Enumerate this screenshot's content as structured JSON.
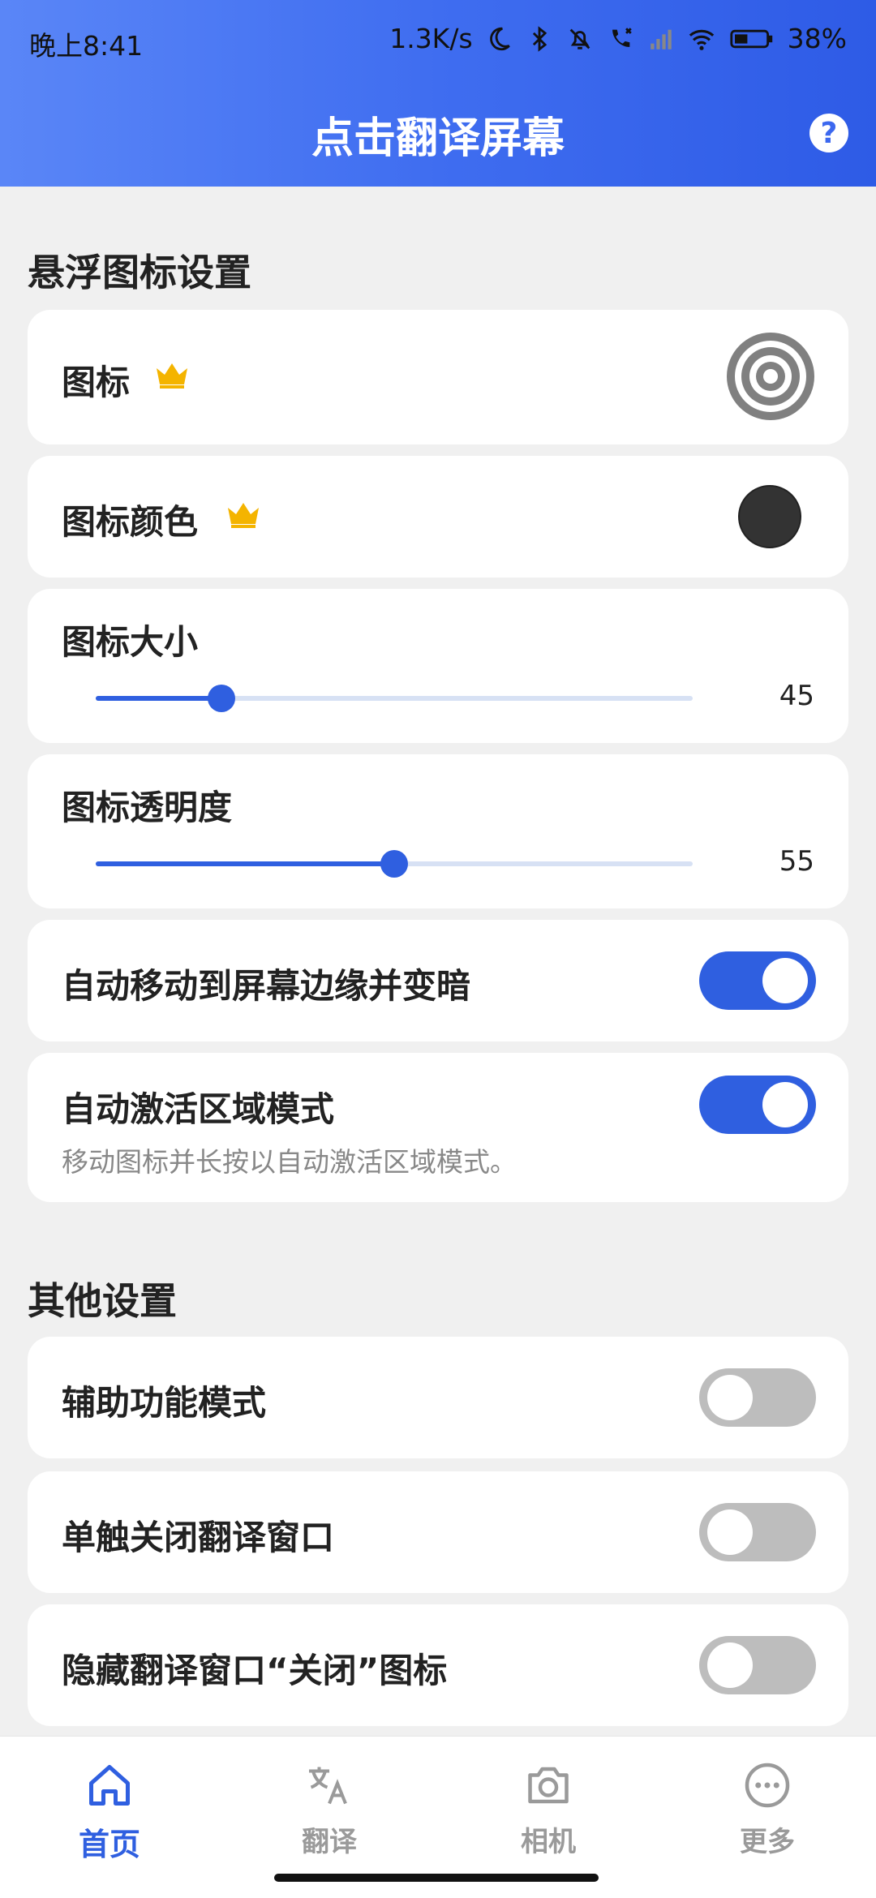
{
  "status_bar": {
    "time": "晚上8:41",
    "net_speed": "1.3K/s",
    "battery": "38%",
    "icons": [
      "moon-icon",
      "bluetooth-icon",
      "bell-off-icon",
      "call-icon",
      "signal-icon",
      "wifi-icon",
      "battery-icon"
    ]
  },
  "header": {
    "title": "点击翻译屏幕",
    "help_label": "?"
  },
  "floating_section": {
    "title": "悬浮图标设置",
    "icon_label": "图标",
    "icon_color_label": "图标颜色",
    "icon_color_value": "#333333",
    "icon_size": {
      "label": "图标大小",
      "value": "45",
      "fraction": 0.21
    },
    "icon_opacity": {
      "label": "图标透明度",
      "value": "55",
      "fraction": 0.5
    },
    "auto_move": {
      "label": "自动移动到屏幕边缘并变暗",
      "on": true
    },
    "auto_activate": {
      "label": "自动激活区域模式",
      "desc": "移动图标并长按以自动激活区域模式。",
      "on": true
    }
  },
  "other_section": {
    "title": "其他设置",
    "accessibility": {
      "label": "辅助功能模式",
      "on": false
    },
    "single_touch_close": {
      "label": "单触关闭翻译窗口",
      "on": false
    },
    "hide_close_icon": {
      "label": "隐藏翻译窗口“关闭”图标",
      "on": false
    }
  },
  "bottom_nav": {
    "items": [
      {
        "label": "首页",
        "icon": "home-icon",
        "active": true
      },
      {
        "label": "翻译",
        "icon": "translate-icon",
        "active": false
      },
      {
        "label": "相机",
        "icon": "camera-icon",
        "active": false
      },
      {
        "label": "更多",
        "icon": "more-icon",
        "active": false
      }
    ]
  },
  "colors": {
    "accent": "#2f5fe0",
    "crown": "#f4b400"
  }
}
